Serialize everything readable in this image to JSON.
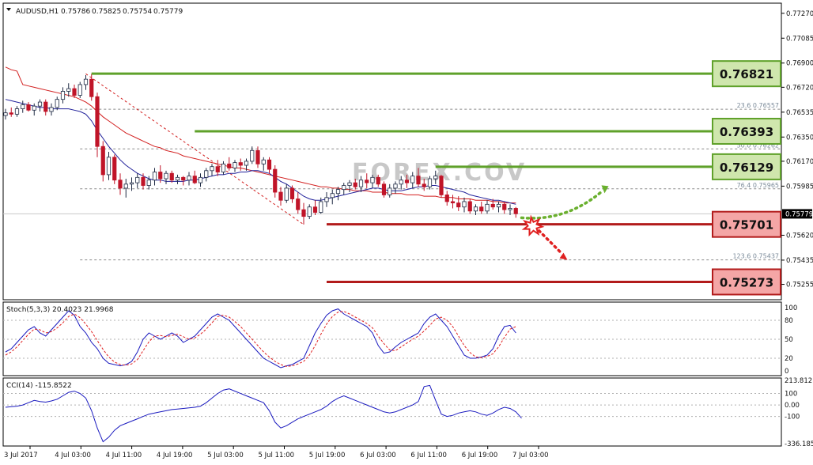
{
  "symbol": "AUDUSD,H1",
  "ohlc": [
    "0.75786",
    "0.75825",
    "0.75754",
    "0.75779"
  ],
  "watermark": "FOREX.COV",
  "colors": {
    "up": "#1f2a44",
    "down": "#c01428",
    "ma_red": "#d21e1e",
    "ma_blue": "#20209a",
    "resistance": "#5fa12a",
    "support": "#b21b1b",
    "res_box": "#cfe6ad",
    "sup_box": "#f4a6a6",
    "stoch_main": "#1a1abf",
    "stoch_signal": "#e02020",
    "cci": "#1a1abf"
  },
  "price_axis": {
    "min": 0.7517,
    "max": 0.7731,
    "ticks": [
      "0.77270",
      "0.77085",
      "0.76900",
      "0.76720",
      "0.76535",
      "0.76350",
      "0.76170",
      "0.75985",
      "0.75620",
      "0.75435",
      "0.75255"
    ],
    "current": "0.75779"
  },
  "fib_labels": [
    {
      "text": "23.6 0.76557",
      "price": 0.76557
    },
    {
      "text": "50.0 0.76262",
      "price": 0.76262
    },
    {
      "text": "76.4 0.75965",
      "price": 0.75965
    },
    {
      "text": "123.6 0.75437",
      "price": 0.75437
    }
  ],
  "levels": [
    {
      "label": "0.76821",
      "price": 0.76821,
      "type": "resistance",
      "from_bar": 15
    },
    {
      "label": "0.76393",
      "price": 0.76393,
      "type": "resistance",
      "from_bar": 33
    },
    {
      "label": "0.76129",
      "price": 0.76129,
      "type": "resistance",
      "from_bar": 75
    },
    {
      "label": "0.75701",
      "price": 0.75701,
      "type": "support",
      "from_bar": 56
    },
    {
      "label": "0.75273",
      "price": 0.75273,
      "type": "support",
      "from_bar": 56
    }
  ],
  "time_labels": [
    "3 Jul 2017",
    "4 Jul 03:00",
    "4 Jul 11:00",
    "4 Jul 19:00",
    "5 Jul 03:00",
    "5 Jul 11:00",
    "5 Jul 19:00",
    "6 Jul 03:00",
    "6 Jul 11:00",
    "6 Jul 19:00",
    "7 Jul 03:00"
  ],
  "stoch": {
    "title": "Stoch(5,3,3) 20.4023 21.9968",
    "ticks": [
      "100",
      "80",
      "50",
      "20",
      "0"
    ]
  },
  "cci": {
    "title": "CCI(14) -115.8522",
    "ticks": [
      "213.812",
      "100",
      "0.00",
      "-100",
      "-336.185"
    ]
  },
  "chart_data": {
    "type": "candlestick",
    "symbol": "AUDUSD",
    "timeframe": "H1",
    "candles": [
      [
        0.7651,
        0.7656,
        0.7648,
        0.7653
      ],
      [
        0.7653,
        0.7657,
        0.765,
        0.7652
      ],
      [
        0.7652,
        0.7658,
        0.765,
        0.7656
      ],
      [
        0.7656,
        0.7662,
        0.7653,
        0.7659
      ],
      [
        0.7659,
        0.7661,
        0.7654,
        0.7655
      ],
      [
        0.7655,
        0.766,
        0.7651,
        0.7658
      ],
      [
        0.7658,
        0.7663,
        0.7654,
        0.7661
      ],
      [
        0.7661,
        0.7663,
        0.7651,
        0.7654
      ],
      [
        0.7654,
        0.766,
        0.7651,
        0.7657
      ],
      [
        0.7657,
        0.7665,
        0.7655,
        0.7663
      ],
      [
        0.7663,
        0.7672,
        0.766,
        0.7669
      ],
      [
        0.7669,
        0.7675,
        0.7665,
        0.7671
      ],
      [
        0.7671,
        0.7674,
        0.7664,
        0.7666
      ],
      [
        0.7666,
        0.7676,
        0.7664,
        0.7674
      ],
      [
        0.7674,
        0.7681,
        0.767,
        0.7678
      ],
      [
        0.7678,
        0.7682,
        0.7662,
        0.7665
      ],
      [
        0.7665,
        0.7668,
        0.762,
        0.7628
      ],
      [
        0.7628,
        0.7632,
        0.7602,
        0.7607
      ],
      [
        0.7607,
        0.7624,
        0.7603,
        0.762
      ],
      [
        0.762,
        0.7622,
        0.76,
        0.7603
      ],
      [
        0.7603,
        0.7608,
        0.7592,
        0.7597
      ],
      [
        0.7597,
        0.7604,
        0.759,
        0.76
      ],
      [
        0.76,
        0.7605,
        0.7595,
        0.7601
      ],
      [
        0.7601,
        0.7608,
        0.7597,
        0.7605
      ],
      [
        0.7605,
        0.7608,
        0.7596,
        0.7599
      ],
      [
        0.7599,
        0.7606,
        0.7596,
        0.7603
      ],
      [
        0.7603,
        0.7612,
        0.7599,
        0.7609
      ],
      [
        0.7609,
        0.7614,
        0.7601,
        0.7604
      ],
      [
        0.7604,
        0.761,
        0.76,
        0.7608
      ],
      [
        0.7608,
        0.761,
        0.7601,
        0.7603
      ],
      [
        0.7603,
        0.7607,
        0.76,
        0.7605
      ],
      [
        0.7605,
        0.7606,
        0.7599,
        0.7603
      ],
      [
        0.7603,
        0.7609,
        0.7599,
        0.7606
      ],
      [
        0.7606,
        0.761,
        0.76,
        0.7601
      ],
      [
        0.7601,
        0.7608,
        0.7598,
        0.7605
      ],
      [
        0.7605,
        0.7612,
        0.7602,
        0.761
      ],
      [
        0.761,
        0.7615,
        0.7606,
        0.7613
      ],
      [
        0.7613,
        0.7618,
        0.7606,
        0.7609
      ],
      [
        0.7609,
        0.7617,
        0.7607,
        0.7615
      ],
      [
        0.7615,
        0.762,
        0.761,
        0.7612
      ],
      [
        0.7612,
        0.7618,
        0.7609,
        0.7616
      ],
      [
        0.7616,
        0.7619,
        0.761,
        0.7614
      ],
      [
        0.7614,
        0.7619,
        0.761,
        0.7617
      ],
      [
        0.7617,
        0.7628,
        0.7615,
        0.7625
      ],
      [
        0.7625,
        0.7628,
        0.7612,
        0.7615
      ],
      [
        0.7615,
        0.762,
        0.761,
        0.7618
      ],
      [
        0.7618,
        0.762,
        0.7608,
        0.7611
      ],
      [
        0.7611,
        0.7614,
        0.759,
        0.7594
      ],
      [
        0.7594,
        0.7598,
        0.7584,
        0.7588
      ],
      [
        0.7588,
        0.76,
        0.7586,
        0.7597
      ],
      [
        0.7597,
        0.7599,
        0.7586,
        0.7589
      ],
      [
        0.7589,
        0.7594,
        0.7578,
        0.7581
      ],
      [
        0.7581,
        0.7586,
        0.757,
        0.7576
      ],
      [
        0.7576,
        0.7585,
        0.7574,
        0.7583
      ],
      [
        0.7583,
        0.7588,
        0.7577,
        0.7579
      ],
      [
        0.7579,
        0.759,
        0.7578,
        0.7587
      ],
      [
        0.7587,
        0.7594,
        0.7583,
        0.759
      ],
      [
        0.759,
        0.7596,
        0.7585,
        0.7593
      ],
      [
        0.7593,
        0.7598,
        0.7588,
        0.7596
      ],
      [
        0.7596,
        0.7601,
        0.7592,
        0.7599
      ],
      [
        0.7599,
        0.7603,
        0.7594,
        0.7601
      ],
      [
        0.7601,
        0.7604,
        0.7596,
        0.7598
      ],
      [
        0.7598,
        0.7606,
        0.7594,
        0.7603
      ],
      [
        0.7603,
        0.7608,
        0.7597,
        0.7601
      ],
      [
        0.7601,
        0.7607,
        0.7597,
        0.7605
      ],
      [
        0.7605,
        0.7607,
        0.7598,
        0.76
      ],
      [
        0.76,
        0.7602,
        0.759,
        0.7592
      ],
      [
        0.7592,
        0.76,
        0.759,
        0.7597
      ],
      [
        0.7597,
        0.7602,
        0.7593,
        0.76
      ],
      [
        0.76,
        0.7606,
        0.7596,
        0.7603
      ],
      [
        0.7603,
        0.7607,
        0.7597,
        0.7601
      ],
      [
        0.7601,
        0.7609,
        0.7597,
        0.7606
      ],
      [
        0.7606,
        0.7612,
        0.7598,
        0.76
      ],
      [
        0.76,
        0.7604,
        0.7595,
        0.7598
      ],
      [
        0.7598,
        0.7606,
        0.7596,
        0.7604
      ],
      [
        0.7604,
        0.761,
        0.76,
        0.7606
      ],
      [
        0.7606,
        0.7607,
        0.759,
        0.7592
      ],
      [
        0.7592,
        0.7595,
        0.7584,
        0.7587
      ],
      [
        0.7587,
        0.7592,
        0.7582,
        0.7586
      ],
      [
        0.7586,
        0.7591,
        0.758,
        0.7583
      ],
      [
        0.7583,
        0.759,
        0.7579,
        0.7587
      ],
      [
        0.7587,
        0.7589,
        0.7578,
        0.758
      ],
      [
        0.758,
        0.7585,
        0.7577,
        0.7583
      ],
      [
        0.7583,
        0.7587,
        0.7578,
        0.758
      ],
      [
        0.758,
        0.7588,
        0.7578,
        0.7585
      ],
      [
        0.7585,
        0.7589,
        0.7581,
        0.7583
      ],
      [
        0.7583,
        0.7587,
        0.7579,
        0.7585
      ],
      [
        0.7585,
        0.7587,
        0.7578,
        0.7581
      ],
      [
        0.7581,
        0.7585,
        0.7577,
        0.7582
      ],
      [
        0.7582,
        0.7583,
        0.7575,
        0.7578
      ]
    ],
    "ma_red": [
      0.7677,
      0.7676,
      0.7675,
      0.7674,
      0.7673,
      0.7672,
      0.7671,
      0.767,
      0.7669,
      0.7668,
      0.7667,
      0.7666,
      0.7665,
      0.7663,
      0.7661,
      0.7658,
      0.7654,
      0.765,
      0.7647,
      0.7644,
      0.7641,
      0.7638,
      0.7636,
      0.7634,
      0.7632,
      0.763,
      0.7628,
      0.7627,
      0.7625,
      0.7624,
      0.7623,
      0.7621,
      0.762,
      0.7619,
      0.7618,
      0.7617,
      0.7616,
      0.7615,
      0.7614,
      0.7613,
      0.7612,
      0.7612,
      0.7611,
      0.761,
      0.7609,
      0.7608,
      0.7607,
      0.7606,
      0.7605,
      0.7604,
      0.7603,
      0.7602,
      0.7601,
      0.76,
      0.7599,
      0.7598,
      0.7598,
      0.7597,
      0.7597,
      0.7596,
      0.7596,
      0.7595,
      0.7595,
      0.7595,
      0.7594,
      0.7594,
      0.7594,
      0.7593,
      0.7593,
      0.7593,
      0.7592,
      0.7592,
      0.7592,
      0.7591,
      0.7591,
      0.7591,
      0.759,
      0.759,
      0.759,
      0.7589,
      0.7589,
      0.7589,
      0.7588,
      0.7588,
      0.7588,
      0.7587,
      0.7587,
      0.7586,
      0.7586,
      0.7586
    ],
    "ma_blue": [
      0.7663,
      0.7662,
      0.7661,
      0.766,
      0.7659,
      0.7658,
      0.7657,
      0.7657,
      0.7656,
      0.7656,
      0.7656,
      0.7656,
      0.7655,
      0.7654,
      0.7652,
      0.7647,
      0.764,
      0.7634,
      0.7628,
      0.7623,
      0.7618,
      0.7614,
      0.7611,
      0.7608,
      0.7606,
      0.7604,
      0.7603,
      0.7603,
      0.7602,
      0.7602,
      0.7602,
      0.7602,
      0.7603,
      0.7603,
      0.7604,
      0.7605,
      0.7606,
      0.7607,
      0.7607,
      0.7608,
      0.7608,
      0.7609,
      0.7609,
      0.761,
      0.761,
      0.7609,
      0.7608,
      0.7605,
      0.7602,
      0.76,
      0.7597,
      0.7594,
      0.7591,
      0.7589,
      0.7588,
      0.7588,
      0.7589,
      0.759,
      0.7591,
      0.7592,
      0.7593,
      0.7594,
      0.7595,
      0.7596,
      0.7597,
      0.7597,
      0.7596,
      0.7595,
      0.7595,
      0.7595,
      0.7596,
      0.7597,
      0.7598,
      0.7598,
      0.7599,
      0.7599,
      0.7598,
      0.7597,
      0.7596,
      0.7595,
      0.7594,
      0.7592,
      0.7591,
      0.759,
      0.7589,
      0.7588,
      0.7588,
      0.7587,
      0.7586,
      0.7585
    ],
    "stoch_main": [
      30,
      35,
      45,
      55,
      65,
      70,
      60,
      55,
      65,
      75,
      85,
      95,
      88,
      70,
      60,
      45,
      35,
      20,
      12,
      10,
      8,
      10,
      15,
      30,
      50,
      60,
      55,
      50,
      55,
      60,
      55,
      45,
      50,
      55,
      65,
      75,
      85,
      90,
      85,
      80,
      70,
      60,
      50,
      40,
      30,
      20,
      15,
      10,
      5,
      8,
      10,
      15,
      20,
      40,
      60,
      75,
      88,
      95,
      98,
      90,
      85,
      80,
      75,
      70,
      60,
      40,
      28,
      30,
      38,
      45,
      50,
      55,
      60,
      75,
      85,
      90,
      80,
      70,
      55,
      40,
      25,
      20,
      20,
      22,
      25,
      35,
      55,
      70,
      72,
      60
    ],
    "stoch_signal": [
      25,
      30,
      38,
      48,
      58,
      66,
      65,
      60,
      62,
      68,
      76,
      86,
      90,
      84,
      74,
      62,
      48,
      34,
      22,
      14,
      10,
      9,
      11,
      18,
      32,
      46,
      55,
      56,
      54,
      56,
      58,
      54,
      50,
      52,
      58,
      66,
      76,
      86,
      88,
      85,
      78,
      70,
      60,
      50,
      40,
      30,
      22,
      15,
      10,
      7,
      8,
      11,
      15,
      25,
      40,
      58,
      74,
      86,
      93,
      94,
      90,
      85,
      80,
      75,
      68,
      55,
      43,
      33,
      32,
      38,
      44,
      50,
      55,
      63,
      72,
      82,
      85,
      80,
      70,
      55,
      40,
      29,
      22,
      21,
      23,
      27,
      38,
      53,
      66,
      70
    ],
    "cci": [
      -20,
      -15,
      -10,
      0,
      20,
      40,
      30,
      25,
      35,
      50,
      80,
      110,
      120,
      100,
      60,
      -50,
      -200,
      -320,
      -280,
      -220,
      -180,
      -160,
      -140,
      -120,
      -100,
      -80,
      -70,
      -60,
      -50,
      -40,
      -35,
      -30,
      -25,
      -20,
      -10,
      20,
      60,
      100,
      130,
      140,
      120,
      100,
      80,
      60,
      40,
      20,
      -50,
      -150,
      -200,
      -180,
      -150,
      -120,
      -100,
      -80,
      -60,
      -40,
      -10,
      30,
      60,
      80,
      60,
      40,
      20,
      0,
      -20,
      -40,
      -60,
      -70,
      -60,
      -40,
      -20,
      0,
      30,
      160,
      170,
      40,
      -80,
      -100,
      -90,
      -70,
      -60,
      -50,
      -60,
      -80,
      -90,
      -70,
      -40,
      -20,
      -30,
      -60,
      -115
    ]
  }
}
